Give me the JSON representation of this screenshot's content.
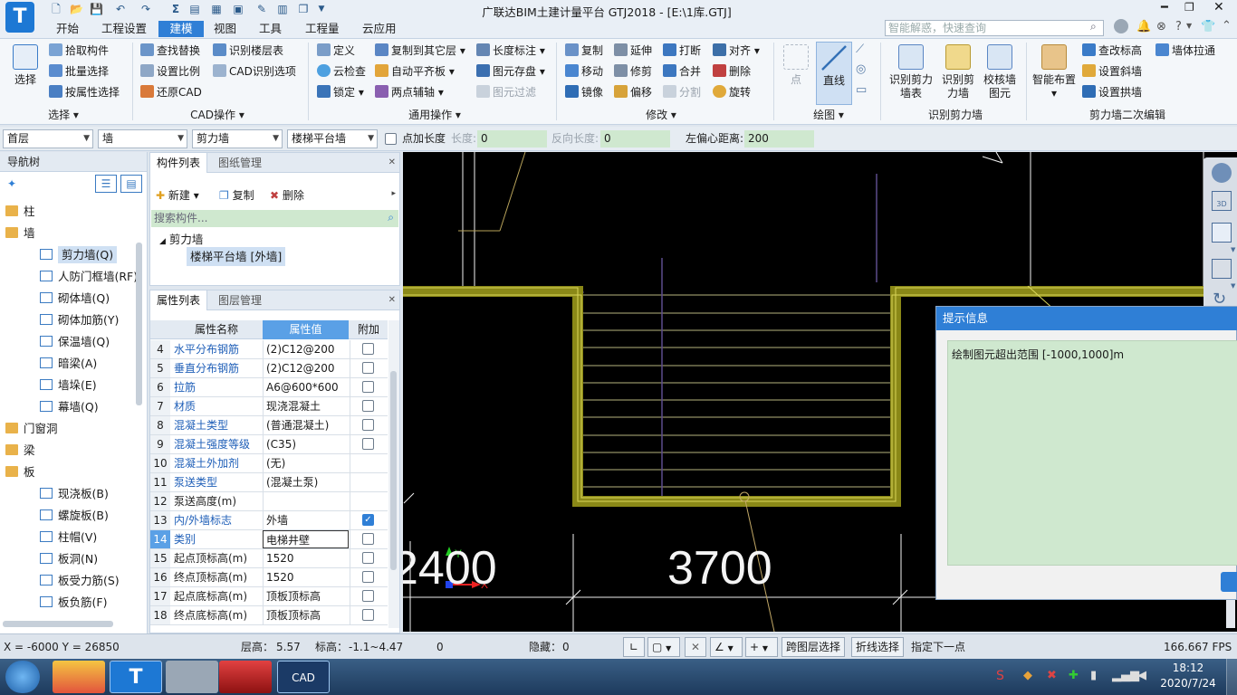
{
  "window": {
    "title": "广联达BIM土建计量平台 GTJ2018 - [E:\\1库.GTJ]",
    "logo": "T"
  },
  "search": {
    "placeholder": "智能解惑，快速查询"
  },
  "menu": [
    "开始",
    "工程设置",
    "建模",
    "视图",
    "工具",
    "工程量",
    "云应用"
  ],
  "menu_active": "建模",
  "ribbon": {
    "select": {
      "big": "选择",
      "items": [
        "拾取构件",
        "批量选择",
        "按属性选择"
      ],
      "label": "选择"
    },
    "cad": {
      "items": [
        "查找替换",
        "设置比例",
        "还原CAD",
        "识别楼层表",
        "CAD识别选项"
      ],
      "label": "CAD操作"
    },
    "general": {
      "items": [
        "定义",
        "云检查",
        "锁定",
        "复制到其它层",
        "自动平齐板",
        "两点辅轴",
        "长度标注",
        "图元存盘",
        "图元过滤"
      ],
      "label": "通用操作"
    },
    "modify": {
      "items": [
        "复制",
        "移动",
        "镜像",
        "延伸",
        "修剪",
        "偏移",
        "打断",
        "合并",
        "分割",
        "对齐",
        "删除",
        "旋转"
      ],
      "label": "修改"
    },
    "draw": {
      "items": [
        "点",
        "直线"
      ],
      "label": "绘图"
    },
    "recog": {
      "items": [
        "识别剪力墙表",
        "识别剪力墙",
        "校核墙图元"
      ],
      "label": "识别剪力墙"
    },
    "edit2": {
      "items": [
        "智能布置",
        "查改标高",
        "设置斜墙",
        "设置拱墙",
        "墙体拉通"
      ],
      "label": "剪力墙二次编辑"
    }
  },
  "propbar": {
    "floor": "首层",
    "type": "墙",
    "subtype": "剪力墙",
    "name": "楼梯平台墙",
    "pt_len": "点加长度",
    "len_label": "长度:",
    "len": "0",
    "rev_label": "反向长度:",
    "rev": "0",
    "off_label": "左偏心距离:",
    "off": "200"
  },
  "nav": {
    "title": "导航树",
    "items": [
      {
        "label": "柱",
        "level": 0,
        "icon": "folder-icon"
      },
      {
        "label": "墙",
        "level": 0,
        "icon": "folder-icon"
      },
      {
        "label": "剪力墙(Q)",
        "level": 1,
        "icon": "shear-wall-icon",
        "selected": true
      },
      {
        "label": "人防门框墙(RF)",
        "level": 1,
        "icon": "door-frame-wall-icon"
      },
      {
        "label": "砌体墙(Q)",
        "level": 1,
        "icon": "masonry-wall-icon"
      },
      {
        "label": "砌体加筋(Y)",
        "level": 1,
        "icon": "masonry-rebar-icon"
      },
      {
        "label": "保温墙(Q)",
        "level": 1,
        "icon": "insulation-wall-icon"
      },
      {
        "label": "暗梁(A)",
        "level": 1,
        "icon": "hidden-beam-icon"
      },
      {
        "label": "墙垛(E)",
        "level": 1,
        "icon": "wall-pier-icon"
      },
      {
        "label": "幕墙(Q)",
        "level": 1,
        "icon": "curtain-wall-icon"
      },
      {
        "label": "门窗洞",
        "level": 0,
        "icon": "folder-icon"
      },
      {
        "label": "梁",
        "level": 0,
        "icon": "folder-icon"
      },
      {
        "label": "板",
        "level": 0,
        "icon": "folder-icon"
      },
      {
        "label": "现浇板(B)",
        "level": 1,
        "icon": "cast-slab-icon"
      },
      {
        "label": "螺旋板(B)",
        "level": 1,
        "icon": "spiral-slab-icon"
      },
      {
        "label": "柱帽(V)",
        "level": 1,
        "icon": "column-cap-icon"
      },
      {
        "label": "板洞(N)",
        "level": 1,
        "icon": "slab-hole-icon"
      },
      {
        "label": "板受力筋(S)",
        "level": 1,
        "icon": "slab-rebar-icon"
      },
      {
        "label": "板负筋(F)",
        "level": 1,
        "icon": "slab-neg-rebar-icon"
      }
    ]
  },
  "comp": {
    "tabs": [
      "构件列表",
      "图纸管理"
    ],
    "toolbar": [
      "新建",
      "复制",
      "删除"
    ],
    "search_placeholder": "搜索构件...",
    "tree_parent": "剪力墙",
    "tree_child": "楼梯平台墙 [外墙]"
  },
  "attr": {
    "tabs": [
      "属性列表",
      "图层管理"
    ],
    "headers": [
      "属性名称",
      "属性值",
      "附加"
    ],
    "rows": [
      {
        "n": "4",
        "k": "水平分布钢筋",
        "v": "(2)C12@200",
        "c": "off",
        "blue": true
      },
      {
        "n": "5",
        "k": "垂直分布钢筋",
        "v": "(2)C12@200",
        "c": "off",
        "blue": true
      },
      {
        "n": "6",
        "k": "拉筋",
        "v": "A6@600*600",
        "c": "off",
        "blue": true
      },
      {
        "n": "7",
        "k": "材质",
        "v": "现浇混凝土",
        "c": "off",
        "blue": true
      },
      {
        "n": "8",
        "k": "混凝土类型",
        "v": "(普通混凝土)",
        "c": "off",
        "blue": true
      },
      {
        "n": "9",
        "k": "混凝土强度等级",
        "v": "(C35)",
        "c": "off",
        "blue": true
      },
      {
        "n": "10",
        "k": "混凝土外加剂",
        "v": "(无)",
        "c": "none",
        "blue": true
      },
      {
        "n": "11",
        "k": "泵送类型",
        "v": "(混凝土泵)",
        "c": "none",
        "blue": true
      },
      {
        "n": "12",
        "k": "泵送高度(m)",
        "v": "",
        "c": "none",
        "blue": false
      },
      {
        "n": "13",
        "k": "内/外墙标志",
        "v": "外墙",
        "c": "on",
        "blue": true
      },
      {
        "n": "14",
        "k": "类别",
        "v": "电梯井壁",
        "c": "off",
        "blue": true,
        "active": true
      },
      {
        "n": "15",
        "k": "起点顶标高(m)",
        "v": "1520",
        "c": "off",
        "blue": false
      },
      {
        "n": "16",
        "k": "终点顶标高(m)",
        "v": "1520",
        "c": "off",
        "blue": false
      },
      {
        "n": "17",
        "k": "起点底标高(m)",
        "v": "顶板顶标高",
        "c": "off",
        "blue": false
      },
      {
        "n": "18",
        "k": "终点底标高(m)",
        "v": "顶板顶标高",
        "c": "off",
        "blue": false
      }
    ]
  },
  "canvas": {
    "dim_left": "2400",
    "dim_right": "3700"
  },
  "dialog": {
    "title": "提示信息",
    "message": "绘制图元超出范围 [-1000,1000]m"
  },
  "status": {
    "coords": "X = -6000 Y = 26850",
    "floor_h_label": "层高：",
    "floor_h": "5.57",
    "elev_label": "标高：",
    "elev": "-1.1~4.47",
    "count": "0",
    "hidden_label": "隐藏：",
    "hidden": "0",
    "cross_layer": "跨图层选择",
    "polyline": "折线选择",
    "prompt": "指定下一点",
    "fps": "166.667 FPS"
  },
  "taskbar": {
    "time": "18:12",
    "date": "2020/7/24",
    "cad_label": "CAD"
  },
  "colors": {
    "accent": "#2f7fd6",
    "wall": "#9c9a1e",
    "canvas": "#000000",
    "dialog_body": "#cfe8cf"
  }
}
